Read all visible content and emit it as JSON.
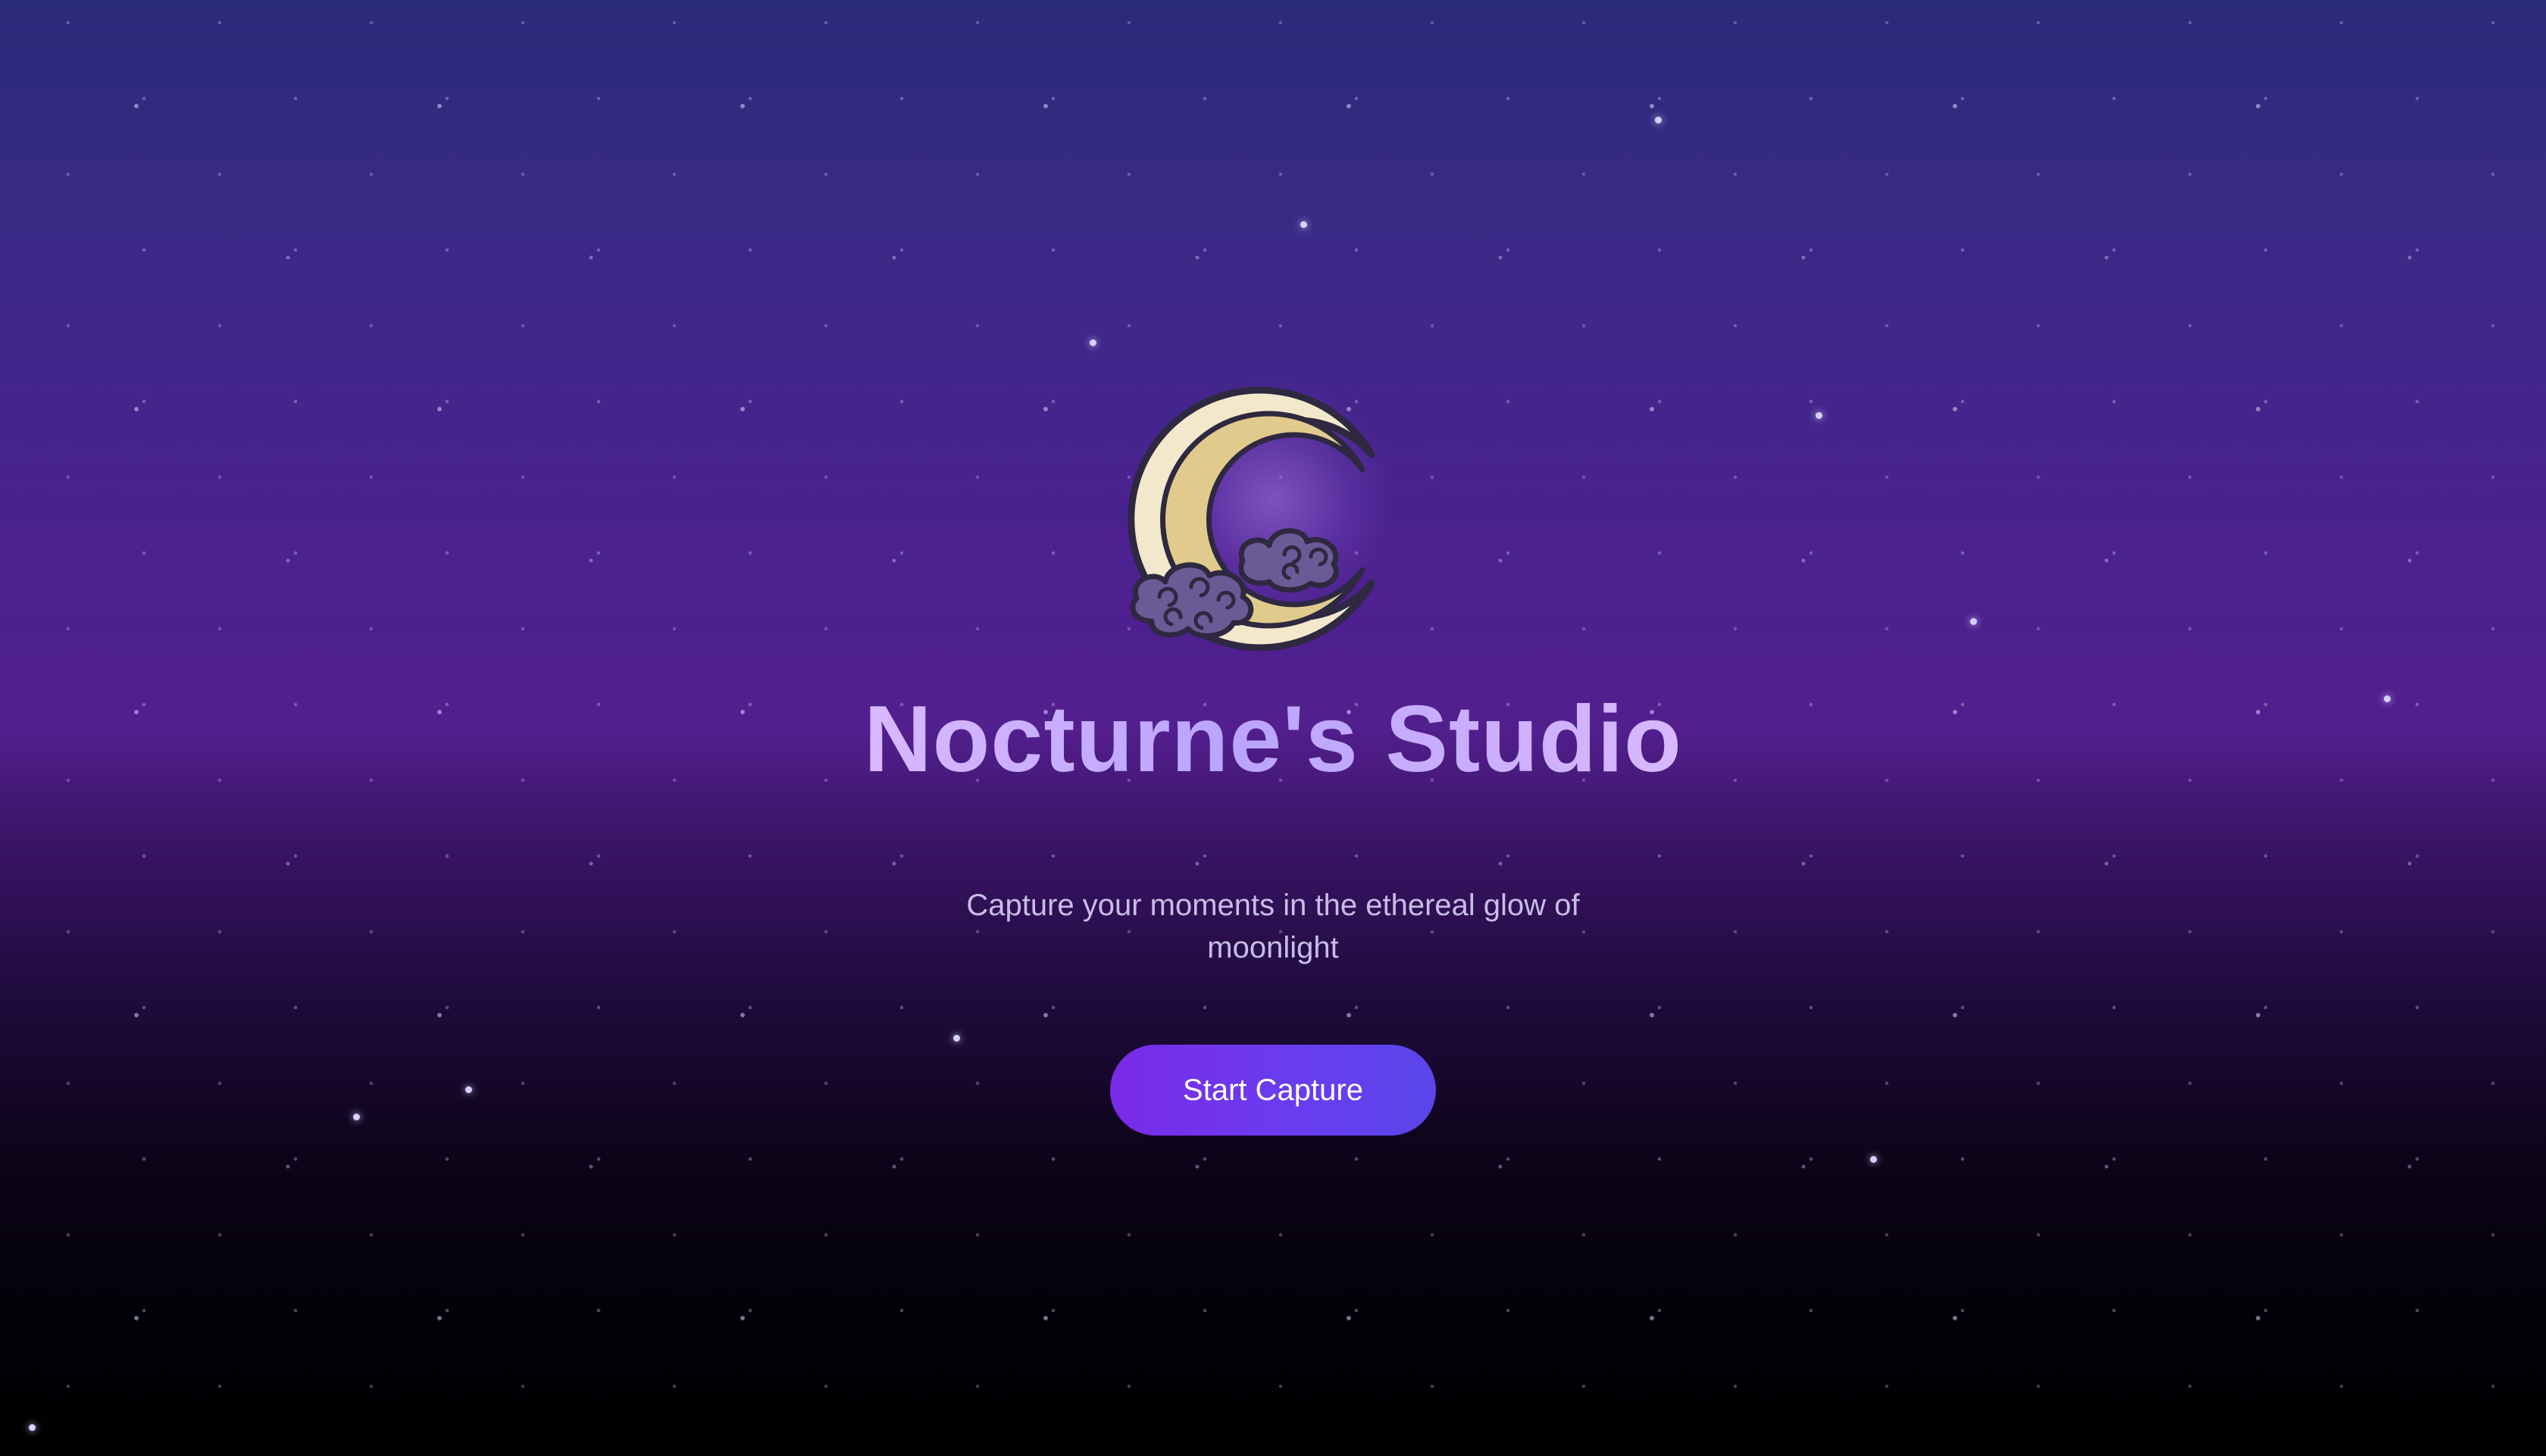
{
  "hero": {
    "logo_icon": "crescent-moon-with-clouds-icon",
    "title": "Nocturne's Studio",
    "subtitle": "Capture your moments in the ethereal glow of moonlight",
    "cta_label": "Start Capture"
  },
  "colors": {
    "background_top": "#2a2a7a",
    "background_mid": "#521f8e",
    "background_bottom": "#000000",
    "title_gradient_start": "#d9b8ff",
    "title_gradient_mid": "#b9a4ff",
    "subtitle": "#c8bde6",
    "button_gradient_start": "#7a2ae6",
    "button_gradient_end": "#5a45ea",
    "moon_light": "#f3e8cc",
    "moon_dark": "#e0cb8c",
    "cloud": "#6a5a96",
    "outline": "#2e2840"
  }
}
